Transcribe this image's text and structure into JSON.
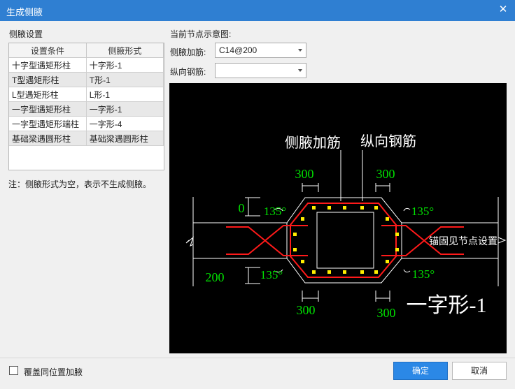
{
  "window": {
    "title": "生成侧腋",
    "close_glyph": "✕"
  },
  "left_panel": {
    "heading": "侧腋设置",
    "columns": [
      "设置条件",
      "侧腋形式"
    ],
    "rows": [
      [
        "十字型遇矩形柱",
        "十字形-1"
      ],
      [
        "T型遇矩形柱",
        "T形-1"
      ],
      [
        "L型遇矩形柱",
        "L形-1"
      ],
      [
        "一字型遇矩形柱",
        "一字形-1"
      ],
      [
        "一字型遇矩形端柱",
        "一字形-4"
      ],
      [
        "基础梁遇圆形柱",
        "基础梁遇圆形柱"
      ]
    ],
    "note": "注：侧腋形式为空，表示不生成侧腋。"
  },
  "right_panel": {
    "heading": "当前节点示意图:",
    "side_rebar_label": "侧腋加筋:",
    "side_rebar_value": "C14@200",
    "long_rebar_label": "纵向钢筋:",
    "long_rebar_value": ""
  },
  "diagram": {
    "label_side_rebar": "侧腋加筋",
    "label_long_rebar": "纵向钢筋",
    "dim_top_left": "300",
    "dim_top_right": "300",
    "dim_bottom_left": "300",
    "dim_bottom_right": "300",
    "dim_zero": "0",
    "dim_200": "200",
    "angle_tl": "135°",
    "angle_tr": "135°",
    "angle_bl": "135°",
    "angle_br": "135°",
    "anchor_text": "锚固见节点设置",
    "form_name": "一字形-1"
  },
  "footer": {
    "checkbox_label": "覆盖同位置加腋",
    "ok_label": "确定",
    "cancel_label": "取消"
  },
  "colors": {
    "titlebar": "#2f7fd2",
    "ok_button": "#2b88e6",
    "rebar": "#ff1a1a",
    "dimension": "#00e000",
    "dots": "#ffee00"
  }
}
